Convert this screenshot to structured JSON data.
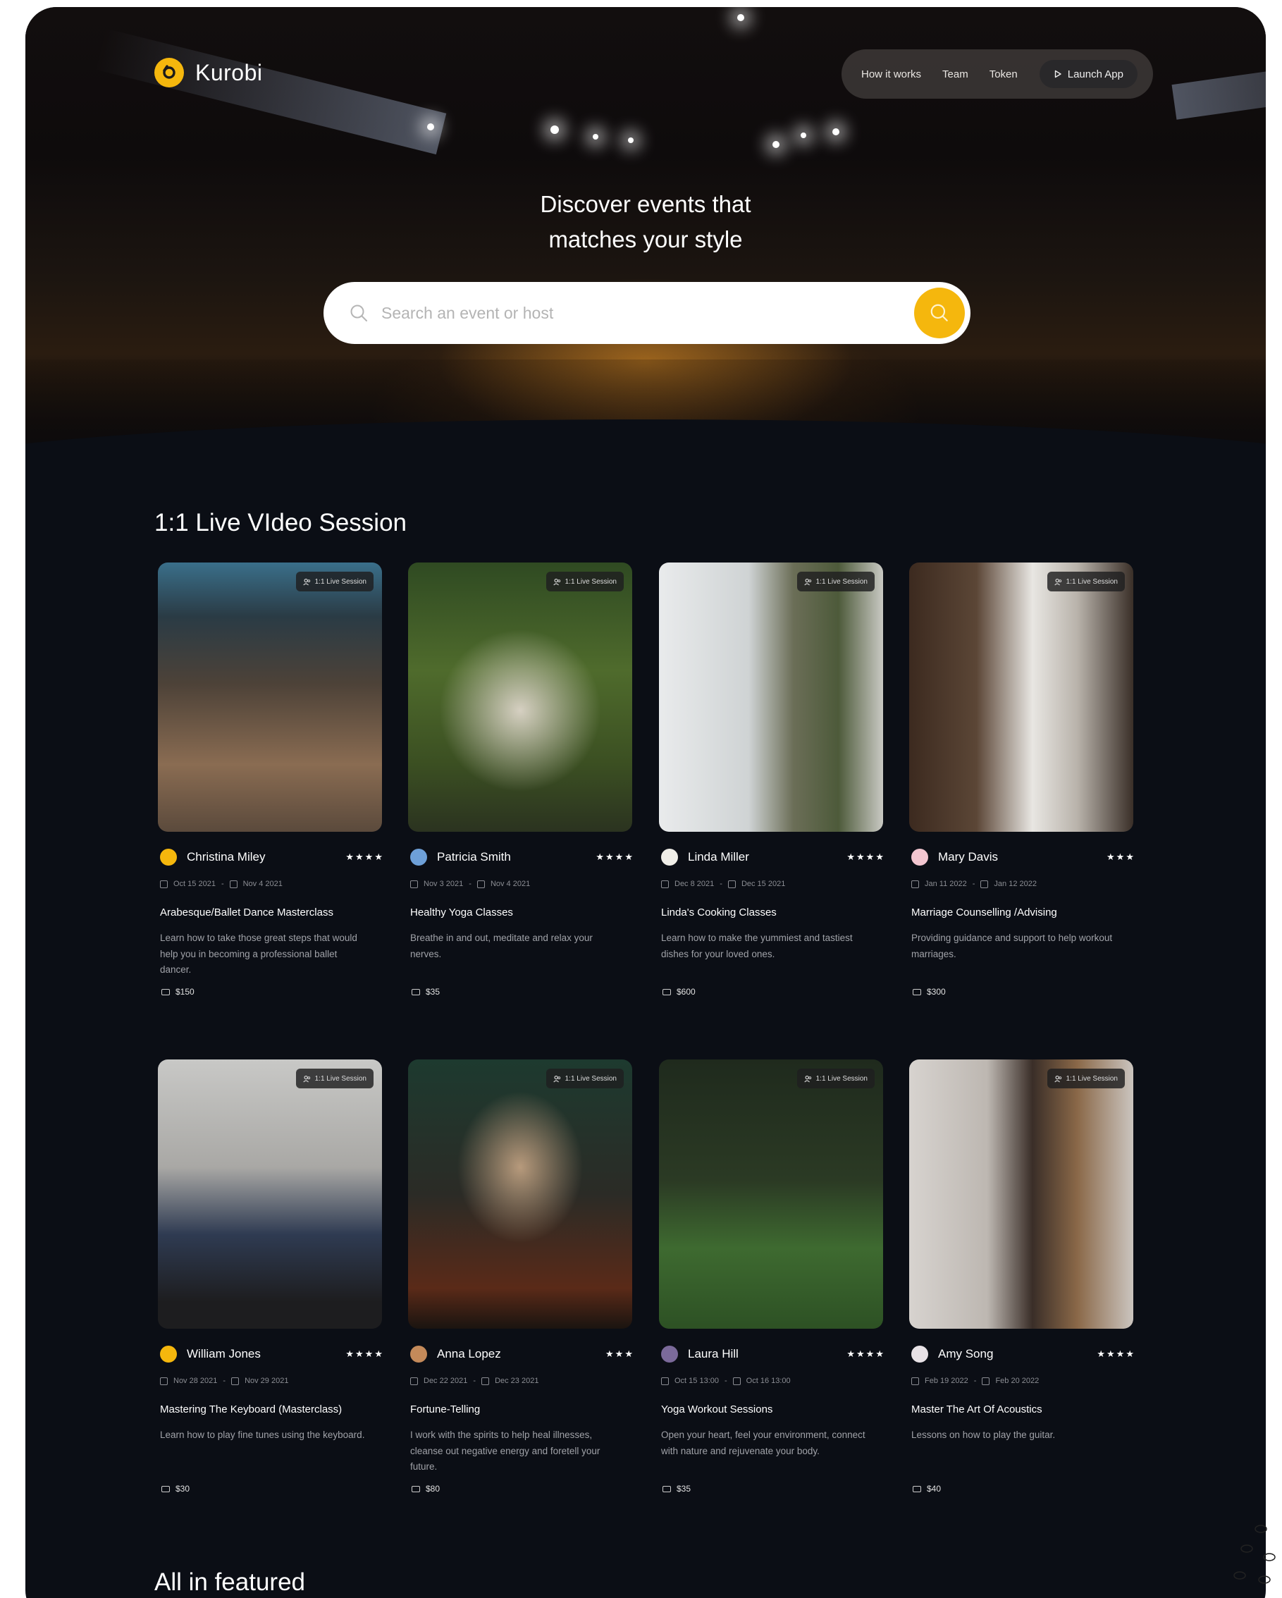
{
  "brand": {
    "name": "Kurobi",
    "accent": "#f5b70d",
    "background": "#0b0e15"
  },
  "nav": {
    "links": [
      "How it works",
      "Team",
      "Token"
    ],
    "launch_label": "Launch App"
  },
  "hero": {
    "title_line1": "Discover events that",
    "title_line2": "matches your style"
  },
  "search": {
    "placeholder": "Search an event or host"
  },
  "section1": {
    "title": "1:1 Live VIdeo Session"
  },
  "section2": {
    "title": "All in featured"
  },
  "cards": [
    {
      "tag": "1:1 Live Session",
      "host": "Christina Miley",
      "stars": "★★★★",
      "start": "Oct 15 2021",
      "end": "Nov 4 2021",
      "title": "Arabesque/Ballet Dance Masterclass",
      "desc": "Learn how to take those great steps that would help you in becoming a professional ballet dancer.",
      "price": "$150"
    },
    {
      "tag": "1:1 Live Session",
      "host": "Patricia Smith",
      "stars": "★★★★",
      "start": "Nov 3 2021",
      "end": "Nov 4 2021",
      "title": "Healthy Yoga Classes",
      "desc": "Breathe in and out, meditate and relax your nerves.",
      "price": "$35"
    },
    {
      "tag": "1:1 Live Session",
      "host": "Linda Miller",
      "stars": "★★★★",
      "start": "Dec 8 2021",
      "end": "Dec 15 2021",
      "title": "Linda's Cooking Classes",
      "desc": "Learn how to make the yummiest and tastiest dishes for your loved ones.",
      "price": "$600"
    },
    {
      "tag": "1:1 Live Session",
      "host": "Mary Davis",
      "stars": "★★★",
      "start": "Jan 11 2022",
      "end": "Jan 12 2022",
      "title": "Marriage Counselling /Advising",
      "desc": "Providing guidance and support to help workout marriages.",
      "price": "$300"
    },
    {
      "tag": "1:1 Live Session",
      "host": "William Jones",
      "stars": "★★★★",
      "start": "Nov 28 2021",
      "end": "Nov 29 2021",
      "title": "Mastering The Keyboard (Masterclass)",
      "desc": "Learn how to play fine tunes using the keyboard.",
      "price": "$30"
    },
    {
      "tag": "1:1 Live Session",
      "host": "Anna Lopez",
      "stars": "★★★",
      "start": "Dec 22 2021",
      "end": "Dec 23 2021",
      "title": "Fortune-Telling",
      "desc": "I work with the spirits to help heal illnesses, cleanse out negative energy and foretell your future.",
      "price": "$80"
    },
    {
      "tag": "1:1 Live Session",
      "host": "Laura Hill",
      "stars": "★★★★",
      "start": "Oct 15 13:00",
      "end": "Oct 16 13:00",
      "title": "Yoga Workout Sessions",
      "desc": "Open your heart, feel your environment, connect with nature and rejuvenate your body.",
      "price": "$35"
    },
    {
      "tag": "1:1 Live Session",
      "host": "Amy Song",
      "stars": "★★★★",
      "start": "Feb 19 2022",
      "end": "Feb 20 2022",
      "title": "Master The Art Of Acoustics",
      "desc": "Lessons on how to play the guitar.",
      "price": "$40"
    }
  ]
}
